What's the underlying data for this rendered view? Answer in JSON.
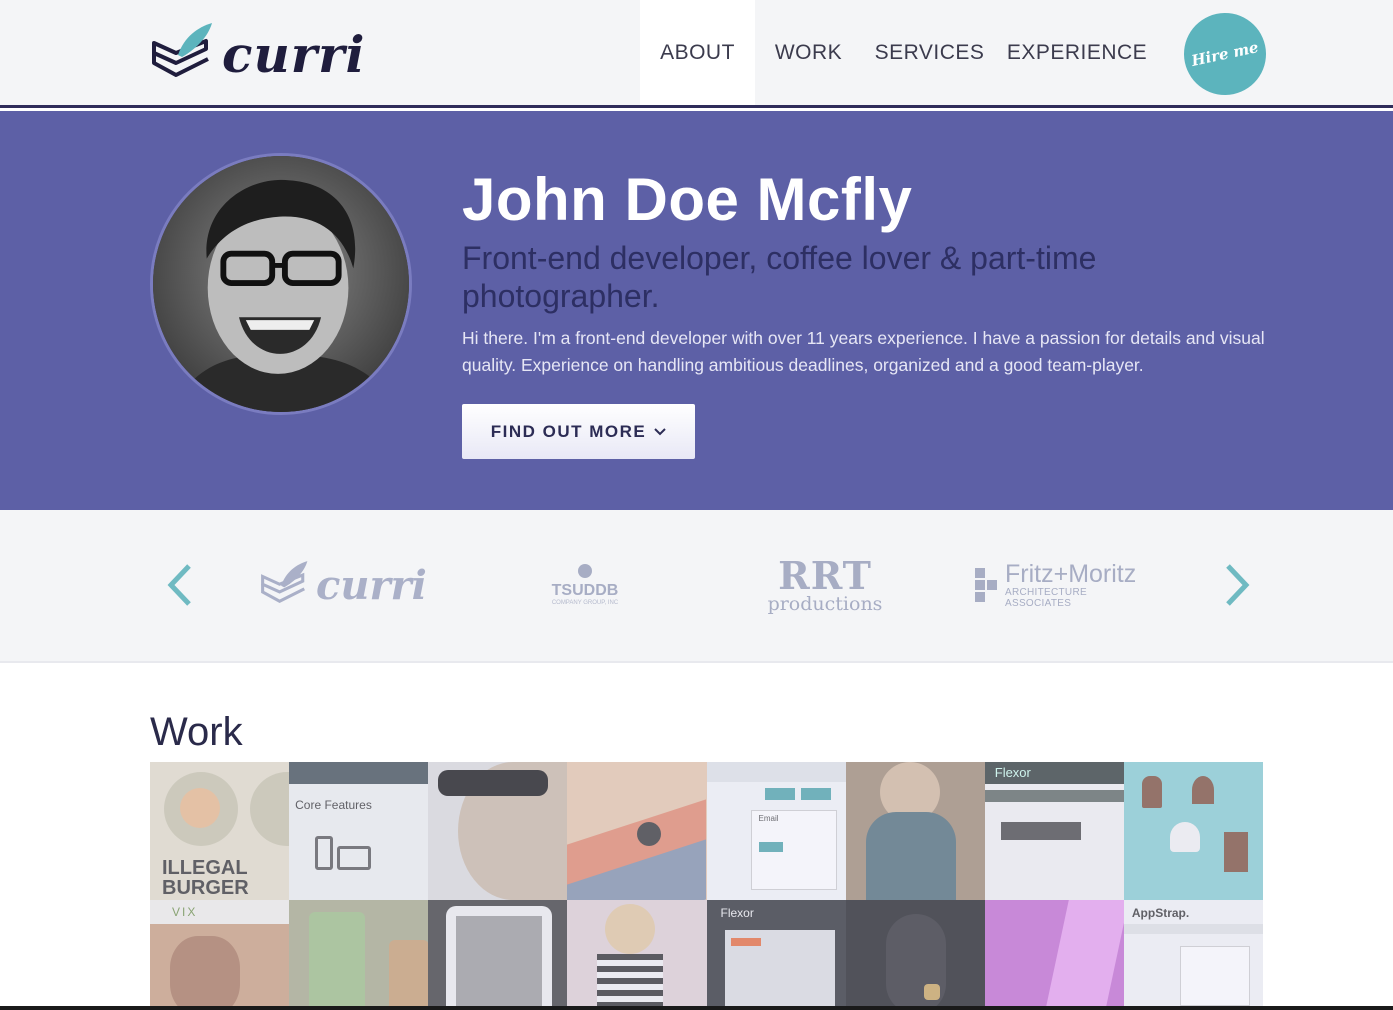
{
  "brand": {
    "name": "curri",
    "accent": "#5d60a6",
    "teal": "#5cb4bd"
  },
  "nav": {
    "items": [
      {
        "label": "ABOUT",
        "active": true
      },
      {
        "label": "WORK",
        "active": false
      },
      {
        "label": "SERVICES",
        "active": false
      },
      {
        "label": "EXPERIENCE",
        "active": false
      }
    ],
    "hire_label": "Hire me"
  },
  "hero": {
    "name": "John Doe Mcfly",
    "tagline": "Front-end developer, coffee lover & part-time photographer.",
    "description": "Hi there. I'm a front-end developer with over 11 years experience. I have a passion for details and visual quality. Experience on handling ambitious deadlines, organized and a good team-player.",
    "cta_label": "FIND OUT MORE",
    "cta_icon": "chevron-down-icon"
  },
  "clients": {
    "logos": [
      {
        "name": "curri"
      },
      {
        "name": "TSUDDB",
        "sub": "COMPANY GROUP, INC"
      },
      {
        "name": "RRT",
        "sub": "productions"
      },
      {
        "name": "Fritz+Moritz",
        "sub": "ARCHITECTURE ASSOCIATES"
      }
    ],
    "prev_icon": "chevron-left-icon",
    "next_icon": "chevron-right-icon"
  },
  "work": {
    "title": "Work",
    "tiles": [
      {
        "text": "ILLEGAL BURGER"
      },
      {
        "text": "Core Features"
      },
      {
        "text": ""
      },
      {
        "text": ""
      },
      {
        "text": "Email"
      },
      {
        "text": ""
      },
      {
        "text": "Flexor"
      },
      {
        "text": ""
      },
      {
        "text": "VIX"
      },
      {
        "text": ""
      },
      {
        "text": ""
      },
      {
        "text": ""
      },
      {
        "text": "Flexor"
      },
      {
        "text": ""
      },
      {
        "text": ""
      },
      {
        "text": "AppStrap."
      }
    ]
  }
}
